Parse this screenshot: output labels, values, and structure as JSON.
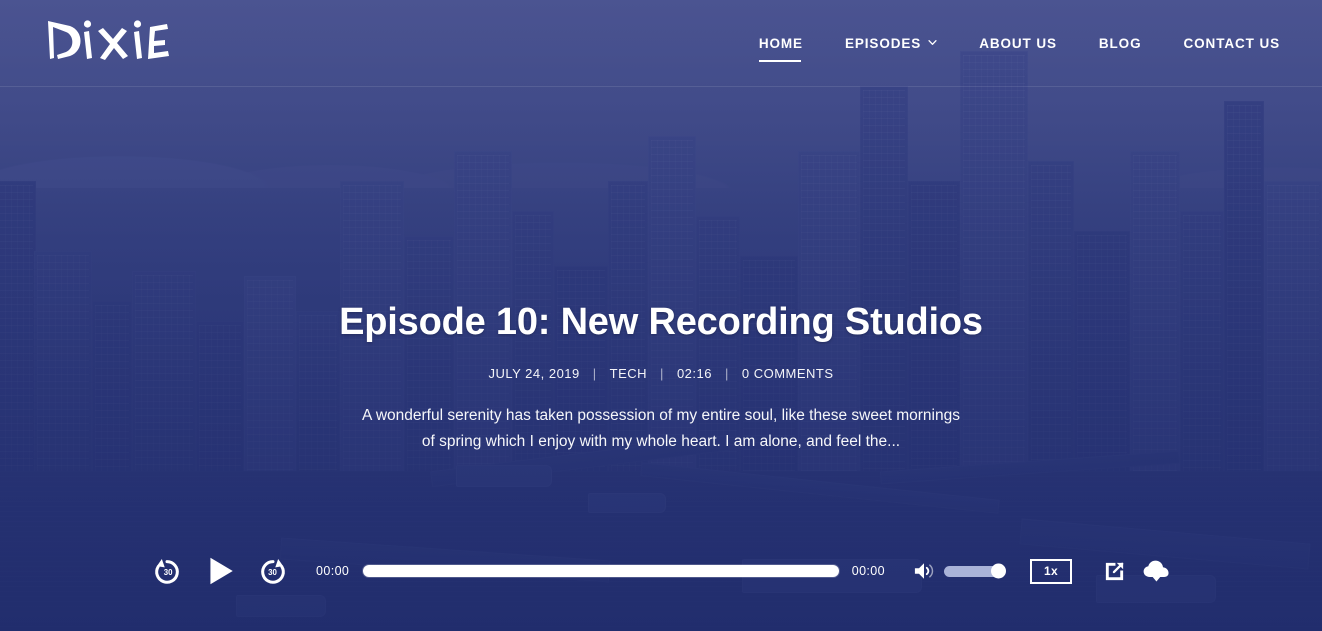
{
  "site": {
    "logo_text": "Dixie",
    "brand_color": "#2d3c78",
    "accent_color": "#ffffff"
  },
  "header": {
    "nav": [
      {
        "label": "HOME",
        "active": true,
        "has_dropdown": false
      },
      {
        "label": "EPISODES",
        "active": false,
        "has_dropdown": true,
        "icon": "chevron-down-icon"
      },
      {
        "label": "ABOUT US",
        "active": false,
        "has_dropdown": false
      },
      {
        "label": "BLOG",
        "active": false,
        "has_dropdown": false
      },
      {
        "label": "CONTACT US",
        "active": false,
        "has_dropdown": false
      }
    ]
  },
  "hero": {
    "episode_title": "Episode 10: New Recording Studios",
    "meta": {
      "date": "JULY 24, 2019",
      "category": "TECH",
      "duration": "02:16",
      "comments": "0 COMMENTS",
      "separator": "|"
    },
    "excerpt": "A wonderful serenity has taken possession of my entire soul, like these sweet mornings of spring which I enjoy with my whole heart. I am alone, and feel the...",
    "background_description": "San Francisco cityscape with blue overlay"
  },
  "player": {
    "rewind_label": "30",
    "rewind_icon": "rewind-30-icon",
    "play_icon": "play-icon",
    "forward_label": "30",
    "forward_icon": "forward-30-icon",
    "current_time": "00:00",
    "duration": "00:00",
    "progress_percent": 0,
    "volume_icon": "volume-icon",
    "volume_percent": 100,
    "speed_label": "1x",
    "share_icon": "share-icon",
    "download_icon": "cloud-download-icon"
  }
}
